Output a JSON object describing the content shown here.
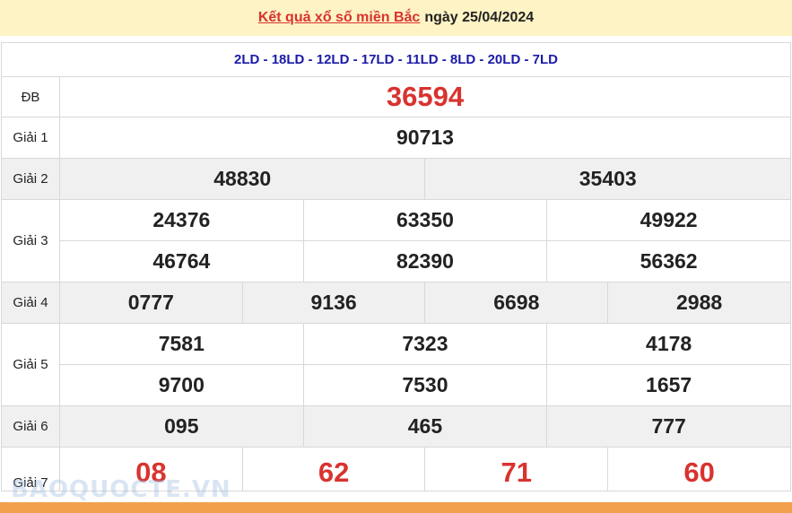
{
  "title": {
    "link_text": "Kết quả xổ số miền Bắc",
    "date_text": "ngày 25/04/2024"
  },
  "codes": "2LD - 18LD - 12LD - 17LD - 11LD - 8LD - 20LD - 7LD",
  "prizes": {
    "db": {
      "label": "ĐB",
      "numbers": [
        "36594"
      ]
    },
    "g1": {
      "label": "Giải 1",
      "numbers": [
        "90713"
      ]
    },
    "g2": {
      "label": "Giải 2",
      "numbers": [
        "48830",
        "35403"
      ]
    },
    "g3": {
      "label": "Giải 3",
      "numbers": [
        "24376",
        "63350",
        "49922",
        "46764",
        "82390",
        "56362"
      ]
    },
    "g4": {
      "label": "Giải 4",
      "numbers": [
        "0777",
        "9136",
        "6698",
        "2988"
      ]
    },
    "g5": {
      "label": "Giải 5",
      "numbers": [
        "7581",
        "7323",
        "4178",
        "9700",
        "7530",
        "1657"
      ]
    },
    "g6": {
      "label": "Giải 6",
      "numbers": [
        "095",
        "465",
        "777"
      ]
    },
    "g7": {
      "label": "Giải 7",
      "numbers": [
        "08",
        "62",
        "71",
        "60"
      ]
    }
  },
  "watermark": "BAOQUOCTE.VN",
  "colors": {
    "header_bg": "#fdf3c4",
    "accent_red": "#d8332f",
    "codes_blue": "#1a1aa8",
    "row_shade": "#f0f0f0",
    "footer_orange": "#f3a04c"
  }
}
